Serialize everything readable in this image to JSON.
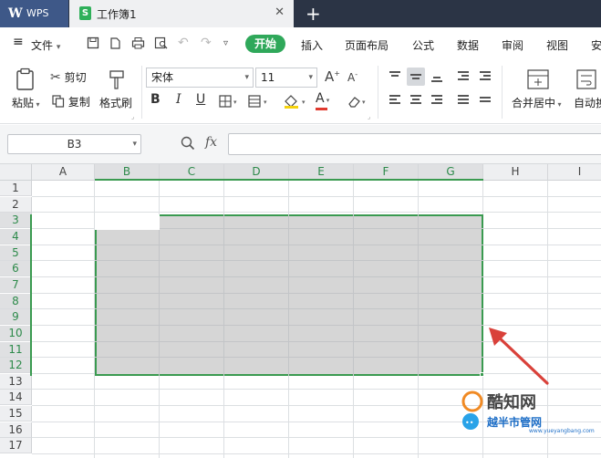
{
  "titlebar": {
    "app_tab": "WPS",
    "workbook_tab": "工作簿1",
    "workbook_icon_letter": "S",
    "close_glyph": "✕",
    "new_tab_glyph": "+"
  },
  "menubar": {
    "file_label": "文件",
    "items": [
      "开始",
      "插入",
      "页面布局",
      "公式",
      "数据",
      "审阅",
      "视图",
      "安"
    ]
  },
  "ribbon": {
    "paste_label": "粘贴",
    "cut_label": "剪切",
    "copy_label": "复制",
    "format_painter_label": "格式刷",
    "font_name": "宋体",
    "font_size": "11",
    "bold": "B",
    "italic": "I",
    "underline": "U",
    "font_color": "A",
    "merge_center_label": "合并居中",
    "auto_wrap_label": "自动换"
  },
  "formulabar": {
    "name_box": "B3",
    "fx_label": "fx",
    "formula_value": ""
  },
  "sheet": {
    "columns": [
      "A",
      "B",
      "C",
      "D",
      "E",
      "F",
      "G",
      "H",
      "I"
    ],
    "rows": [
      "1",
      "2",
      "3",
      "4",
      "5",
      "6",
      "7",
      "8",
      "9",
      "10",
      "11",
      "12",
      "13",
      "14",
      "15",
      "16",
      "17"
    ],
    "selected_range": "B3:G12",
    "active_cell": "B3"
  },
  "watermark": {
    "line1": "酷知网",
    "line2": "越半市管网",
    "line3": "www.yueyangbang.com"
  },
  "colors": {
    "accent_green": "#2fa85a",
    "selection_border": "#3a9a50",
    "arrow_red": "#d9413a",
    "titlebar_bg": "#2b3445"
  }
}
